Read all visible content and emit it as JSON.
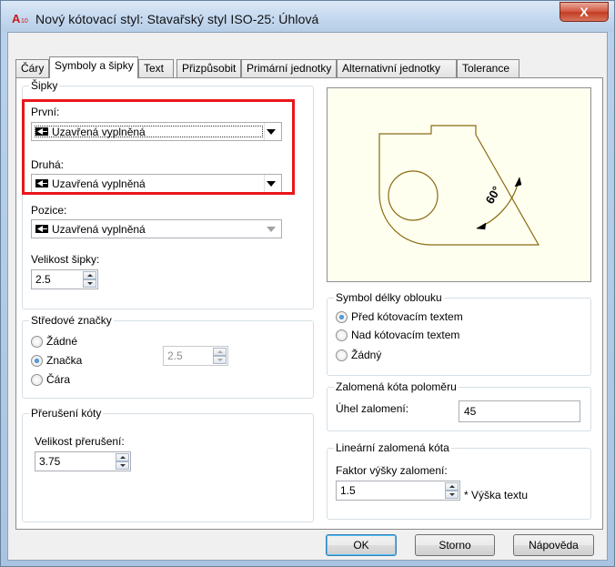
{
  "window": {
    "title": "Nový kótovací styl: Stavařský styl ISO-25: Úhlová",
    "close_label": "X"
  },
  "tabs": [
    {
      "label": "Čáry"
    },
    {
      "label": "Symboly a šipky"
    },
    {
      "label": "Text"
    },
    {
      "label": "Přizpůsobit"
    },
    {
      "label": "Primární jednotky"
    },
    {
      "label": "Alternativní jednotky"
    },
    {
      "label": "Tolerance"
    }
  ],
  "arrows": {
    "group_title": "Šipky",
    "first_label": "První:",
    "first_value": "Uzavřená vyplněná",
    "second_label": "Druhá:",
    "second_value": "Uzavřená vyplněná",
    "leader_label": "Pozice:",
    "leader_value": "Uzavřená vyplněná",
    "size_label": "Velikost šipky:",
    "size_value": "2.5"
  },
  "center_marks": {
    "group_title": "Středové značky",
    "options": [
      "Žádné",
      "Značka",
      "Čára"
    ],
    "selected": "Značka",
    "size_value": "2.5"
  },
  "dim_break": {
    "group_title": "Přerušení kóty",
    "size_label": "Velikost přerušení:",
    "size_value": "3.75"
  },
  "arc_length": {
    "group_title": "Symbol délky oblouku",
    "options": [
      "Před kótovacím textem",
      "Nad kótovacím textem",
      "Žádný"
    ],
    "selected": "Před kótovacím textem"
  },
  "radius_jog": {
    "group_title": "Zalomená kóta poloměru",
    "angle_label": "Úhel zalomení:",
    "angle_value": "45"
  },
  "linear_jog": {
    "group_title": "Lineární zalomená kóta",
    "factor_label": "Faktor výšky zalomení:",
    "factor_value": "1.5",
    "factor_suffix": "* Výška textu"
  },
  "preview": {
    "angle_text": "60°",
    "line_color": "#8a6a10",
    "background": "#fffff0"
  },
  "buttons": {
    "ok": "OK",
    "cancel": "Storno",
    "help": "Nápověda"
  },
  "colors": {
    "highlight": "#e8161b",
    "radio_selected": "#1b66b5"
  }
}
